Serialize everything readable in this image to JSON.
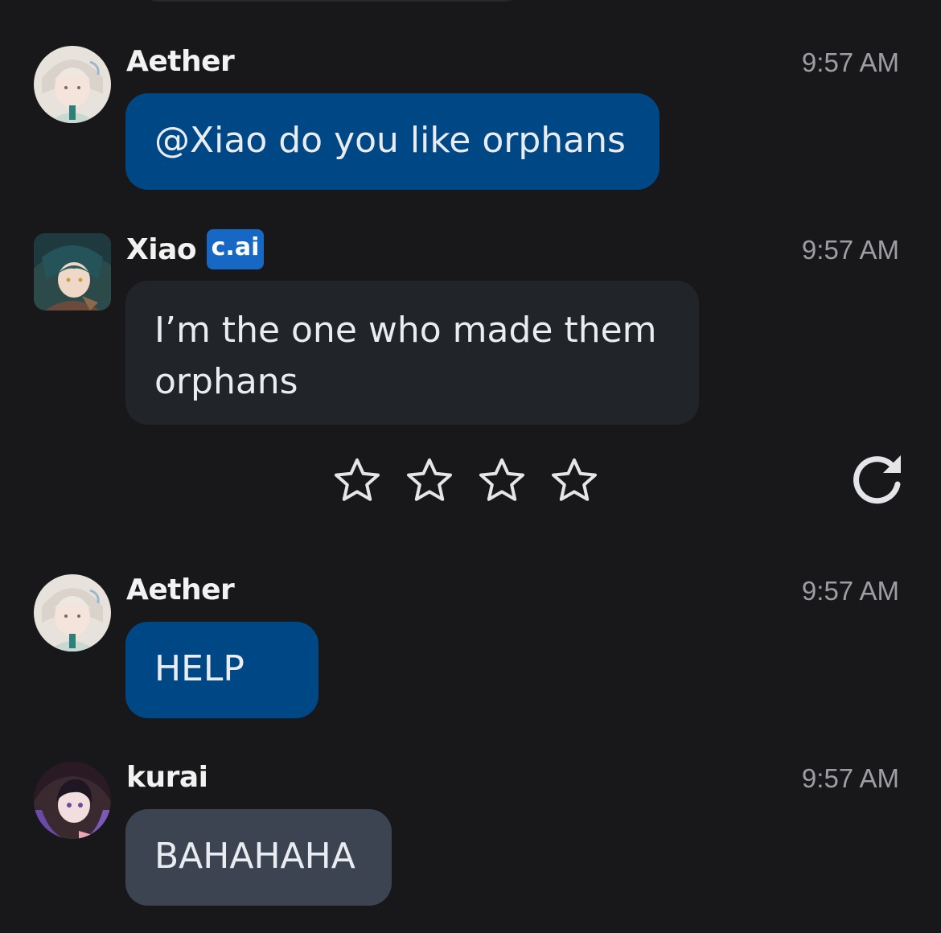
{
  "messages": [
    {
      "sender": "Aether",
      "time": "9:57 AM",
      "text": "@Xiao do you like orphans",
      "avatar": "aether-avatar"
    },
    {
      "sender": "Xiao",
      "badge": "c.ai",
      "time": "9:57 AM",
      "text_line1": "I’m the one who made them",
      "text_line2": "orphans",
      "avatar": "xiao-avatar"
    },
    {
      "sender": "Aether",
      "time": "9:57 AM",
      "text": "HELP",
      "avatar": "aether-avatar"
    },
    {
      "sender": "kurai",
      "time": "9:57 AM",
      "text": "BAHAHAHA",
      "avatar": "kurai-avatar"
    }
  ],
  "rating": {
    "max_stars": 4,
    "selected": 0,
    "icon": "star-outline-icon"
  },
  "regenerate": {
    "icon": "refresh-icon"
  },
  "colors": {
    "background": "#18181b",
    "user_bubble": "#004785",
    "bot_bubble": "#212529",
    "other_bubble": "#3c4451",
    "badge": "#1668c4",
    "timestamp": "#9c9ea3"
  }
}
